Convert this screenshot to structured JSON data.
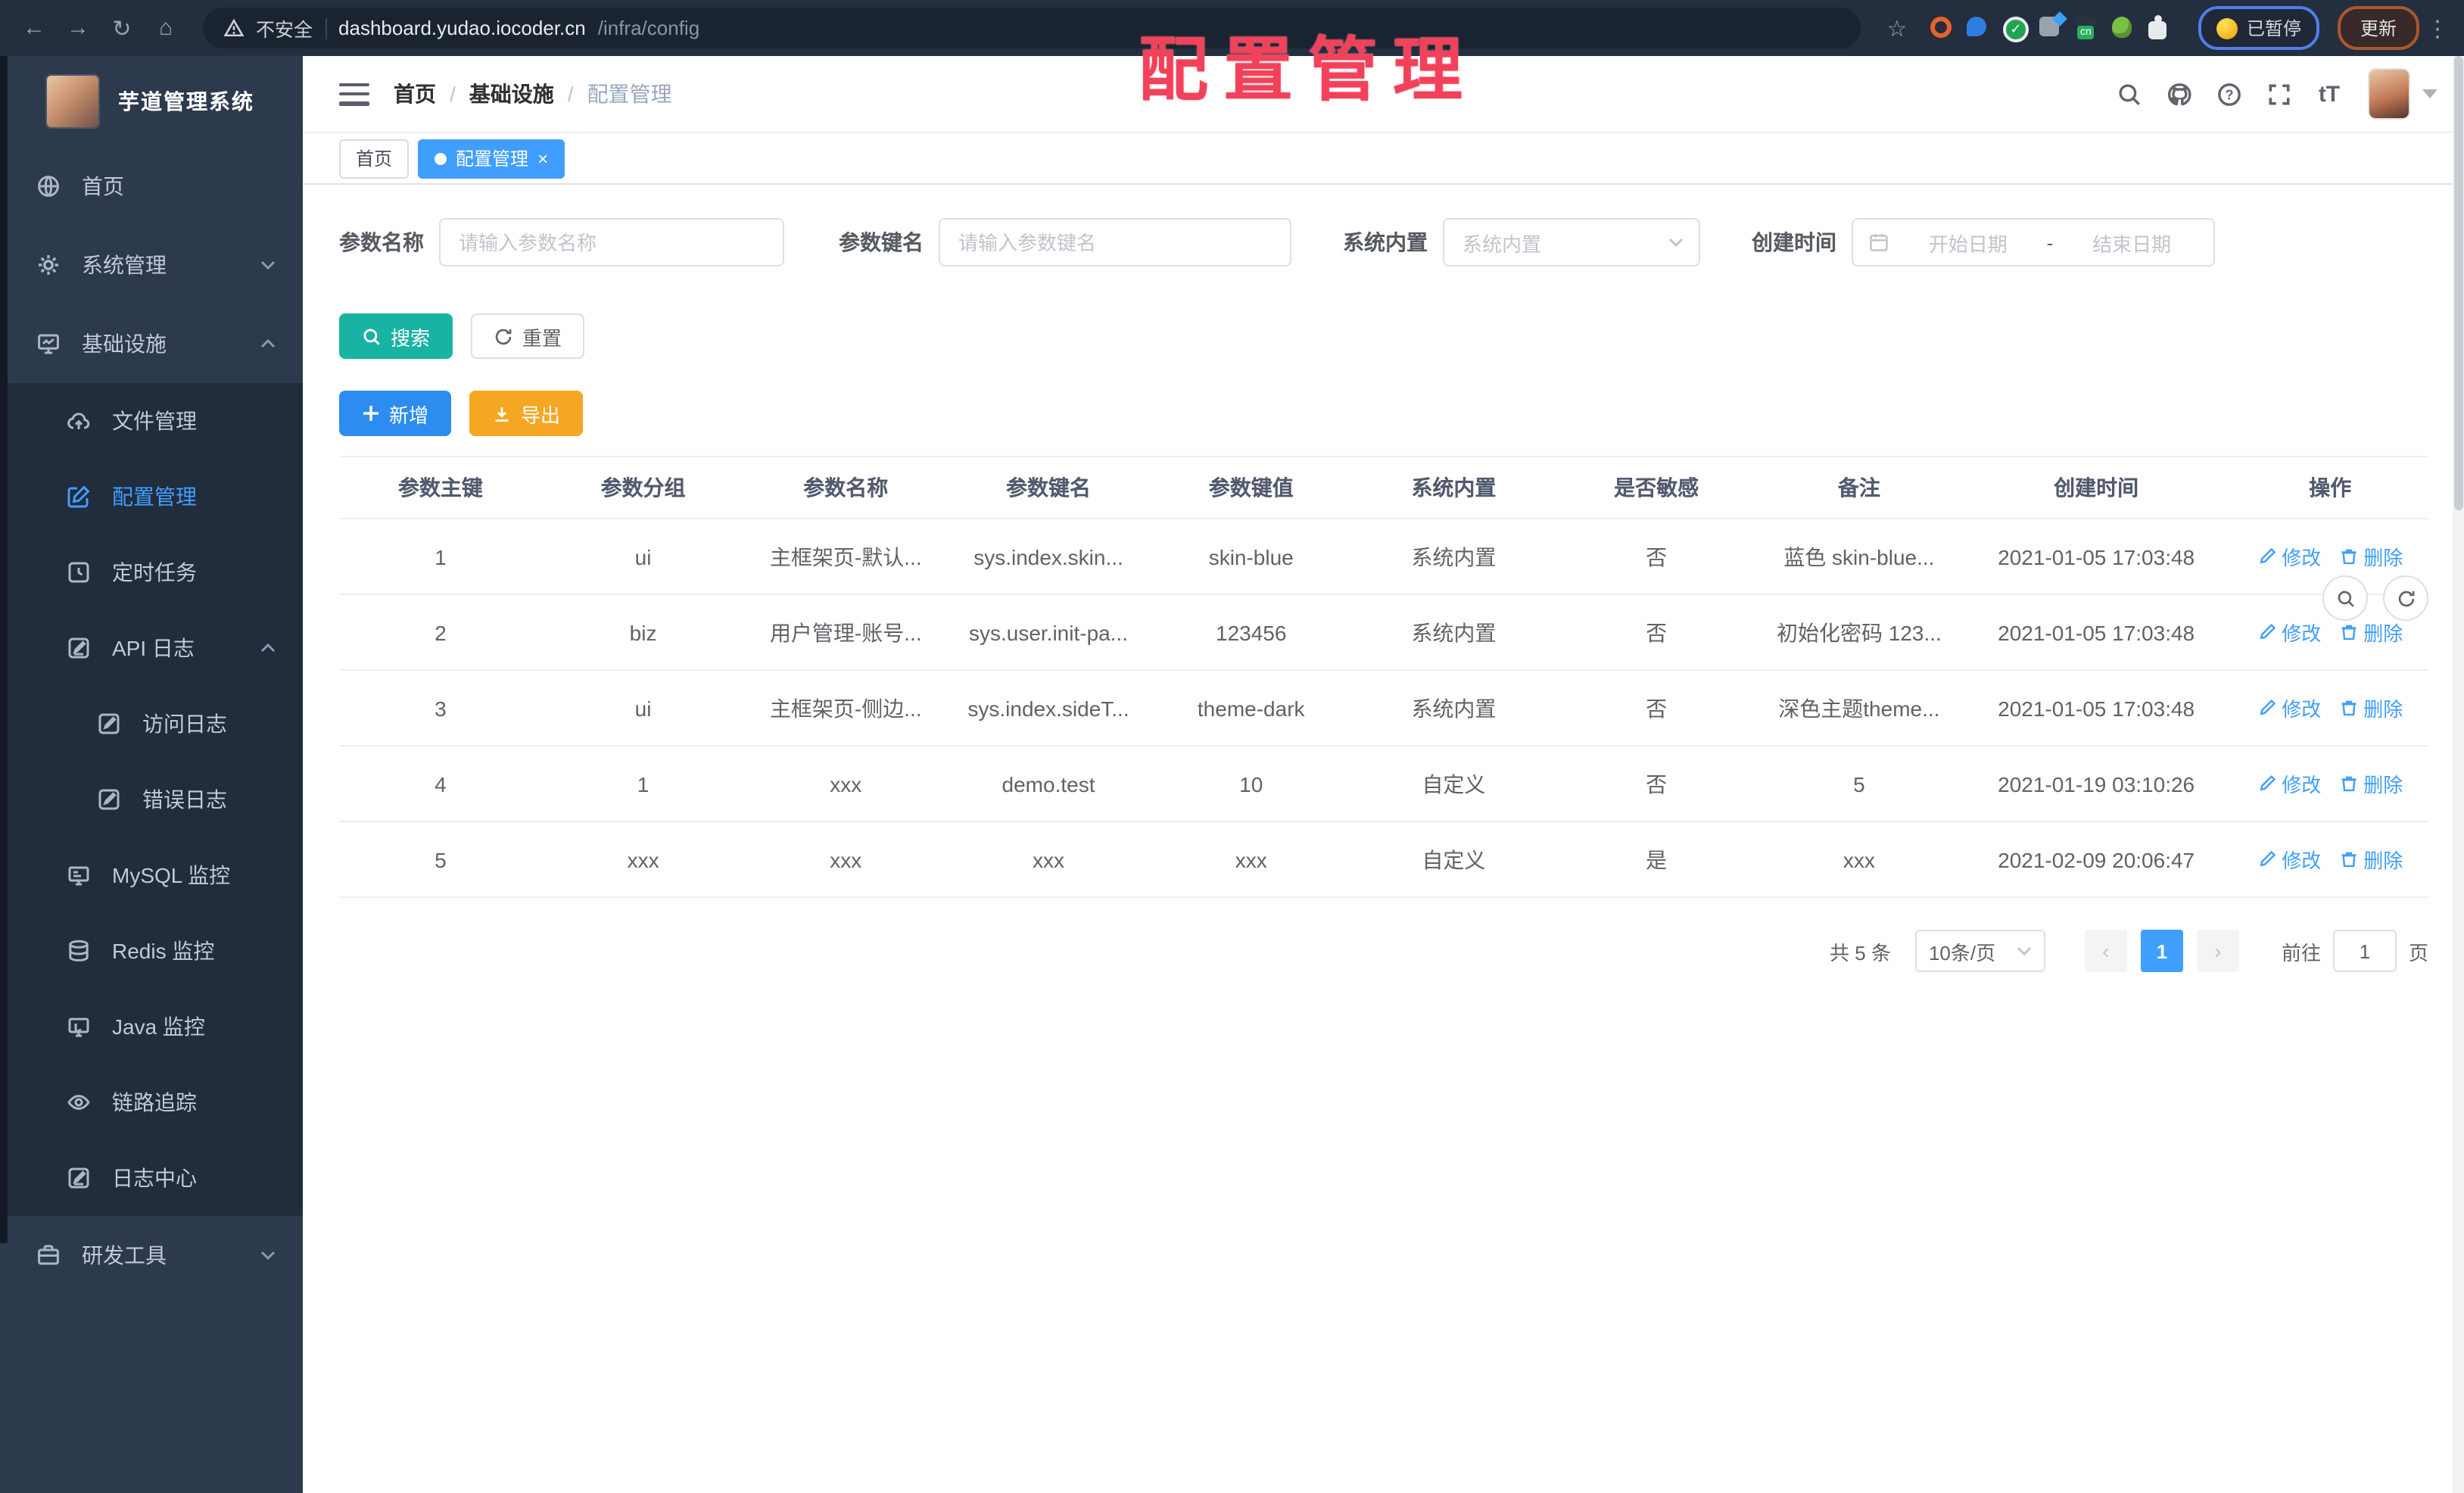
{
  "browser": {
    "security_label": "不安全",
    "url_domain": "dashboard.yudao.iocoder.cn",
    "url_path": "/infra/config",
    "paused_badge": "已暂停",
    "update_button": "更新"
  },
  "overlay": {
    "title": "配置管理"
  },
  "sidebar": {
    "app_title": "芋道管理系统",
    "items": [
      {
        "label": "首页"
      },
      {
        "label": "系统管理"
      },
      {
        "label": "基础设施"
      },
      {
        "label": "文件管理"
      },
      {
        "label": "配置管理"
      },
      {
        "label": "定时任务"
      },
      {
        "label": "API 日志"
      },
      {
        "label": "访问日志"
      },
      {
        "label": "错误日志"
      },
      {
        "label": "MySQL 监控"
      },
      {
        "label": "Redis 监控"
      },
      {
        "label": "Java 监控"
      },
      {
        "label": "链路追踪"
      },
      {
        "label": "日志中心"
      },
      {
        "label": "研发工具"
      }
    ]
  },
  "header": {
    "breadcrumb": [
      "首页",
      "基础设施",
      "配置管理"
    ]
  },
  "tabs": [
    {
      "label": "首页"
    },
    {
      "label": "配置管理"
    }
  ],
  "filters": {
    "name_label": "参数名称",
    "name_placeholder": "请输入参数名称",
    "key_label": "参数键名",
    "key_placeholder": "请输入参数键名",
    "builtin_label": "系统内置",
    "builtin_placeholder": "系统内置",
    "time_label": "创建时间",
    "start_placeholder": "开始日期",
    "range_separator": "-",
    "end_placeholder": "结束日期"
  },
  "actions": {
    "search": "搜索",
    "reset": "重置",
    "add": "新增",
    "export": "导出"
  },
  "table": {
    "columns": [
      "参数主键",
      "参数分组",
      "参数名称",
      "参数键名",
      "参数键值",
      "系统内置",
      "是否敏感",
      "备注",
      "创建时间",
      "操作"
    ],
    "rows": [
      [
        "1",
        "ui",
        "主框架页-默认...",
        "sys.index.skin...",
        "skin-blue",
        "系统内置",
        "否",
        "蓝色 skin-blue...",
        "2021-01-05 17:03:48"
      ],
      [
        "2",
        "biz",
        "用户管理-账号...",
        "sys.user.init-pa...",
        "123456",
        "系统内置",
        "否",
        "初始化密码 123...",
        "2021-01-05 17:03:48"
      ],
      [
        "3",
        "ui",
        "主框架页-侧边...",
        "sys.index.sideT...",
        "theme-dark",
        "系统内置",
        "否",
        "深色主题theme...",
        "2021-01-05 17:03:48"
      ],
      [
        "4",
        "1",
        "xxx",
        "demo.test",
        "10",
        "自定义",
        "否",
        "5",
        "2021-01-19 03:10:26"
      ],
      [
        "5",
        "xxx",
        "xxx",
        "xxx",
        "xxx",
        "自定义",
        "是",
        "xxx",
        "2021-02-09 20:06:47"
      ]
    ],
    "edit_label": "修改",
    "delete_label": "删除"
  },
  "pagination": {
    "total": "共 5 条",
    "page_size": "10条/页",
    "current_page": "1",
    "goto_label": "前往",
    "goto_value": "1",
    "page_unit": "页"
  },
  "colors": {
    "accent": "#409eff",
    "primary_button": "#2d8cf0",
    "search_button": "#18b3a3",
    "export_button": "#f5a623",
    "overlay_red": "#f2415a",
    "sidebar_bg": "#2d3a4d",
    "submenu_bg": "#212c3c",
    "sidebar_text": "#bfcbd9",
    "browser_bar": "#232e3e"
  }
}
